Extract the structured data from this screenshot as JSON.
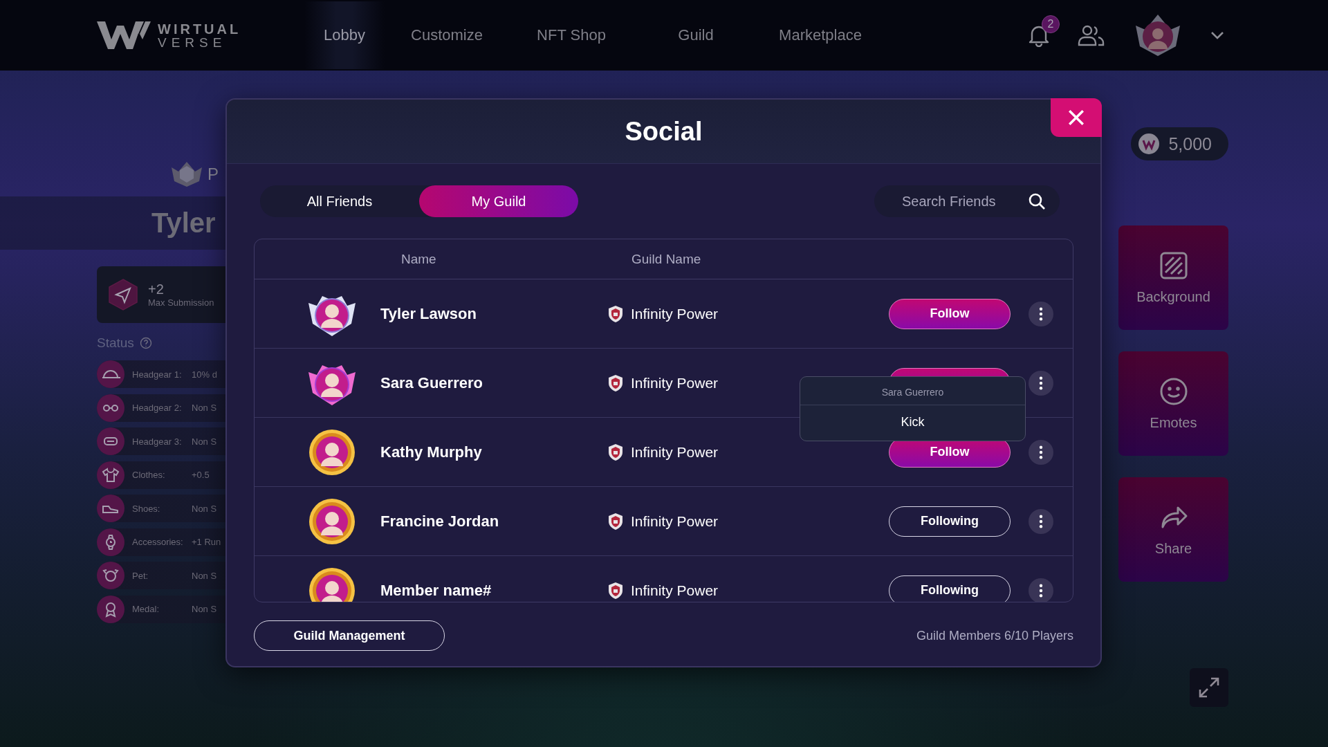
{
  "nav": {
    "logo_top": "WIRTUAL",
    "logo_bottom": "VERSE",
    "items": [
      {
        "label": "Lobby",
        "selected": true
      },
      {
        "label": "Customize",
        "selected": false
      },
      {
        "label": "NFT Shop",
        "selected": false
      },
      {
        "label": "Guild",
        "selected": false
      },
      {
        "label": "Marketplace",
        "selected": false
      }
    ],
    "notification_count": "2"
  },
  "profile": {
    "badge_text": "P",
    "name": "Tyler",
    "perk": {
      "value": "+2",
      "label": "Max Submission"
    },
    "status_title": "Status",
    "status": [
      {
        "kind": "cap",
        "label": "Headgear 1:",
        "value": "10% d"
      },
      {
        "kind": "glasses",
        "label": "Headgear 2:",
        "value": "Non S"
      },
      {
        "kind": "mask",
        "label": "Headgear 3:",
        "value": "Non S"
      },
      {
        "kind": "shirt",
        "label": "Clothes:",
        "value": "+0.5"
      },
      {
        "kind": "shoe",
        "label": "Shoes:",
        "value": "Non S"
      },
      {
        "kind": "watch",
        "label": "Accessories:",
        "value": "+1 Run"
      },
      {
        "kind": "pet",
        "label": "Pet:",
        "value": "Non S"
      },
      {
        "kind": "medal",
        "label": "Medal:",
        "value": "Non S"
      }
    ]
  },
  "wallet": {
    "amount": "5,000"
  },
  "side_actions": [
    {
      "kind": "background",
      "label": "Background"
    },
    {
      "kind": "emotes",
      "label": "Emotes"
    },
    {
      "kind": "share",
      "label": "Share"
    }
  ],
  "dialog": {
    "title": "Social",
    "tabs": [
      {
        "label": "All Friends",
        "selected": false
      },
      {
        "label": "My Guild",
        "selected": true
      }
    ],
    "search": {
      "placeholder": "Search Friends"
    },
    "columns": [
      "Name",
      "Guild Name"
    ],
    "rows": [
      {
        "name": "Tyler Lawson",
        "kind": "wing-silver",
        "guild": "Infinity Power",
        "action": {
          "kind": "follow",
          "label": "Follow"
        }
      },
      {
        "name": "Sara Guerrero",
        "kind": "wing-pink",
        "guild": "Infinity Power",
        "action": {
          "kind": "follow"
        },
        "menu": {
          "title": "Sara Guerrero",
          "items": [
            "Kick"
          ]
        }
      },
      {
        "name": "Kathy Murphy",
        "kind": "gold",
        "guild": "Infinity Power",
        "action": {
          "kind": "follow",
          "label": "Follow"
        }
      },
      {
        "name": "Francine Jordan",
        "kind": "gold",
        "guild": "Infinity Power",
        "action": {
          "kind": "following",
          "label": "Following"
        }
      },
      {
        "name": "Member name#",
        "kind": "gold",
        "guild": "Infinity Power",
        "action": {
          "kind": "following",
          "label": "Following"
        }
      }
    ],
    "footer_button": "Guild Management",
    "members": "Guild Members 6/10 Players"
  }
}
